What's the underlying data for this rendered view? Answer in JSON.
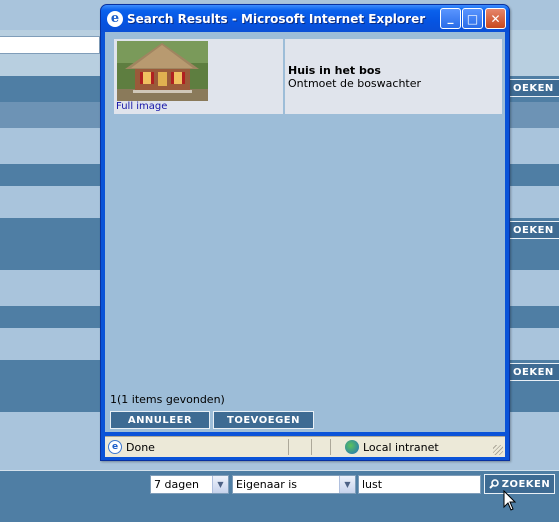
{
  "background": {
    "side_button_label": "OEKEN"
  },
  "popup": {
    "title": "Search Results - Microsoft Internet Explorer",
    "title_buttons": {
      "minimize": "_",
      "maximize": "□",
      "close": "✕"
    },
    "results": [
      {
        "link": "Full image",
        "title": "Huis in het bos",
        "description": "Ontmoet de boswachter"
      }
    ],
    "count_text": "1(1 items gevonden)",
    "cancel_label": "ANNULEER",
    "add_label": "TOEVOEGEN",
    "status_text": "Done",
    "zone_text": "Local intranet"
  },
  "search_bar": {
    "period": "7 dagen",
    "field": "Eigenaar is",
    "query": "lust",
    "search_label": "ZOEKEN"
  },
  "colors": {
    "page_dark": "#4f7ea4",
    "page_light": "#a9c4dc",
    "button": "#3e6b93",
    "titlebar": "#0654e2",
    "client": "#9dbdd8"
  }
}
